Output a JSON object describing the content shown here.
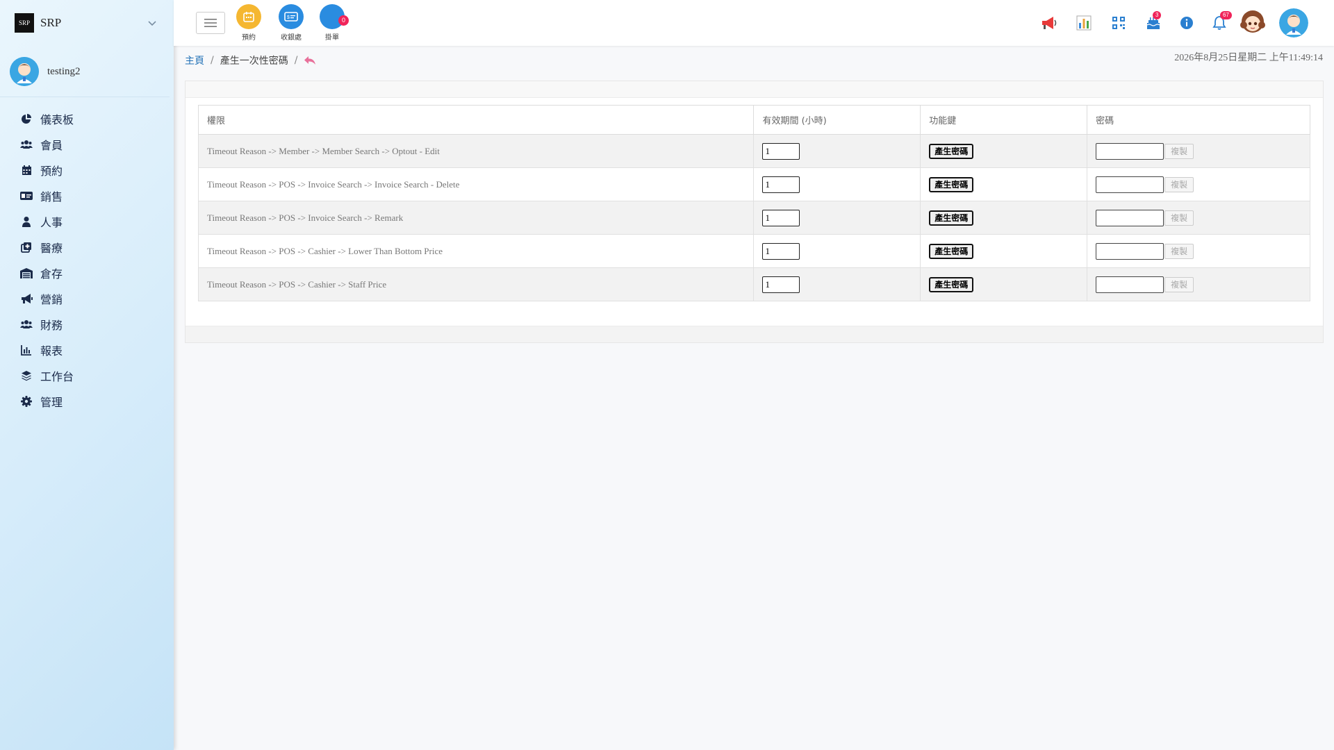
{
  "brand": {
    "name": "SRP",
    "logo_text": "SRP"
  },
  "user": {
    "name": "testing2"
  },
  "sidebar": {
    "items": [
      {
        "label": "儀表板",
        "icon": "pie-chart-icon"
      },
      {
        "label": "會員",
        "icon": "users-icon"
      },
      {
        "label": "預約",
        "icon": "calendar-icon"
      },
      {
        "label": "銷售",
        "icon": "money-card-icon"
      },
      {
        "label": "人事",
        "icon": "person-icon"
      },
      {
        "label": "醫療",
        "icon": "medical-icon"
      },
      {
        "label": "倉存",
        "icon": "warehouse-icon"
      },
      {
        "label": "營銷",
        "icon": "megaphone-icon"
      },
      {
        "label": "財務",
        "icon": "users-icon"
      },
      {
        "label": "報表",
        "icon": "bar-chart-icon"
      },
      {
        "label": "工作台",
        "icon": "layers-icon"
      },
      {
        "label": "管理",
        "icon": "gear-icon"
      }
    ]
  },
  "topbar": {
    "quick": [
      {
        "label": "預約",
        "color": "#f5b731"
      },
      {
        "label": "收銀處",
        "color": "#2a8ce0"
      },
      {
        "label": "掛單",
        "color": "#2a8ce0",
        "badge": "0"
      }
    ],
    "notif_badge_1": "3",
    "notif_badge_2": "67"
  },
  "breadcrumb": {
    "home": "主頁",
    "current": "產生一次性密碼"
  },
  "datetime": "2026年8月25日星期二 上午11:49:14",
  "table": {
    "headers": [
      "權限",
      "有效期間 (小時)",
      "功能鍵",
      "密碼"
    ],
    "generate_label": "產生密碼",
    "copy_label": "複製",
    "rows": [
      {
        "permission": "Timeout Reason -> Member -> Member Search -> Optout - Edit",
        "hours": "1"
      },
      {
        "permission": "Timeout Reason -> POS -> Invoice Search -> Invoice Search - Delete",
        "hours": "1"
      },
      {
        "permission": "Timeout Reason -> POS -> Invoice Search -> Remark",
        "hours": "1"
      },
      {
        "permission": "Timeout Reason -> POS -> Cashier -> Lower Than Bottom Price",
        "hours": "1"
      },
      {
        "permission": "Timeout Reason -> POS -> Cashier -> Staff Price",
        "hours": "1"
      }
    ]
  },
  "colors": {
    "accent": "#1f6fb5",
    "badge": "#f0245a",
    "back_arrow": "#e8709a"
  }
}
